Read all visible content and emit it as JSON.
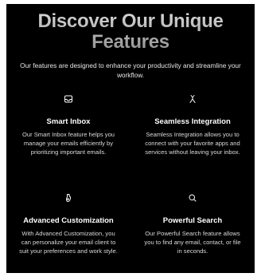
{
  "hero": {
    "title_line1": "Discover Our Unique",
    "title_line2": "Features",
    "subtitle": "Our features are designed to enhance your productivity and streamline your workflow."
  },
  "features": [
    {
      "icon": "inbox-icon",
      "title": "Smart Inbox",
      "description": "Our Smart Inbox feature helps you manage your emails efficiently by prioritizing important emails."
    },
    {
      "icon": "merge-icon",
      "title": "Seamless Integration",
      "description": "Seamless Integration allows you to connect with your favorite apps and services without leaving your inbox."
    },
    {
      "icon": "palette-icon",
      "title": "Advanced Customization",
      "description": "With Advanced Customization, you can personalize your email client to suit your preferences and work style."
    },
    {
      "icon": "search-icon",
      "title": "Powerful Search",
      "description": "Our Powerful Search feature allows you to find any email, contact, or file in seconds."
    }
  ],
  "colors": {
    "background": "#000000",
    "text": "#ffffff",
    "muted": "#d9d9d9"
  }
}
